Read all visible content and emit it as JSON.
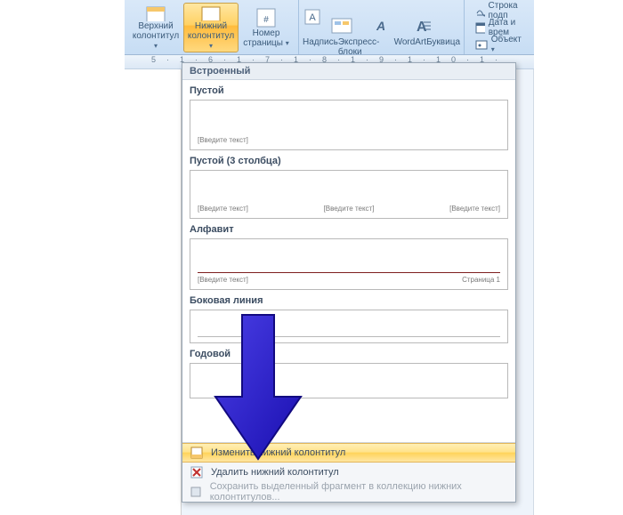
{
  "ribbon": {
    "header_top": "Верхний",
    "header_bot": "колонтитул",
    "footer_top": "Нижний",
    "footer_bot": "колонтитул",
    "page_top": "Номер",
    "page_bot": "страницы",
    "textlabel": "Надпись",
    "quickparts": "Экспресс-блоки",
    "wordart": "WordArt",
    "dropcap": "Буквица",
    "sig": "Строка подп",
    "datetime": "Дата и врем",
    "object": "Объект"
  },
  "ruler": "5·1·6·1·7·1·8·1·9·1·10·1·",
  "panel": {
    "category": "Встроенный",
    "items": {
      "empty": {
        "title": "Пустой",
        "placeholder": "[Введите текст]"
      },
      "cols3": {
        "title": "Пустой (3 столбца)",
        "left": "[Введите текст]",
        "center": "[Введите текст]",
        "right": "[Введите текст]"
      },
      "alpha": {
        "title": "Алфавит",
        "left": "[Введите текст]",
        "right": "Страница 1"
      },
      "side": {
        "title": "Боковая линия"
      },
      "year": {
        "title": "Годовой"
      }
    },
    "actions": {
      "edit": "Изменить нижний колонтитул",
      "remove": "Удалить нижний колонтитул",
      "save": "Сохранить выделенный фрагмент в коллекцию нижних колонтитулов..."
    }
  }
}
